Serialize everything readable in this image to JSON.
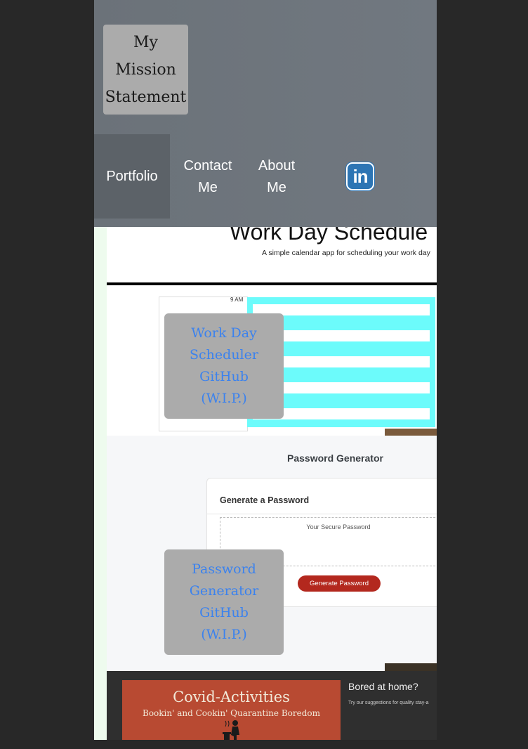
{
  "header": {
    "mission": "My\nMission\nStatement",
    "nav": [
      {
        "label": "Portfolio"
      },
      {
        "label": "Contact\nMe"
      },
      {
        "label": "About\nMe"
      }
    ],
    "linkedin_icon": "linkedin-icon",
    "linkedin_text": "in"
  },
  "projects": [
    {
      "link_label": "Work Day\nScheduler\nGitHub\n(W.I.P.)",
      "preview": {
        "title": "Work Day Schedule",
        "subtitle": "A simple calendar app for scheduling your work day",
        "time": "9 AM"
      }
    },
    {
      "link_label": "Password\nGenerator\nGitHub\n(W.I.P.)",
      "preview": {
        "title": "Password Generator",
        "heading": "Generate a Password",
        "placeholder": "Your Secure Password",
        "button": "Generate Password"
      }
    },
    {
      "preview": {
        "title": "Covid-Activities",
        "subtitle": "Bookin' and Cookin' Quarantine Boredom",
        "heading": "Bored at home?",
        "text": "Try our suggestions for quality stay-a"
      }
    }
  ],
  "colors": {
    "header_bg": "#6b7279",
    "nav_active_bg": "#5c6268",
    "link_text": "#3b82ee",
    "overlay_bg": "#ababab",
    "scheduler_accent": "#6cfbfb",
    "generate_button": "#b3281e",
    "linkedin_blue": "#2d75b4"
  }
}
